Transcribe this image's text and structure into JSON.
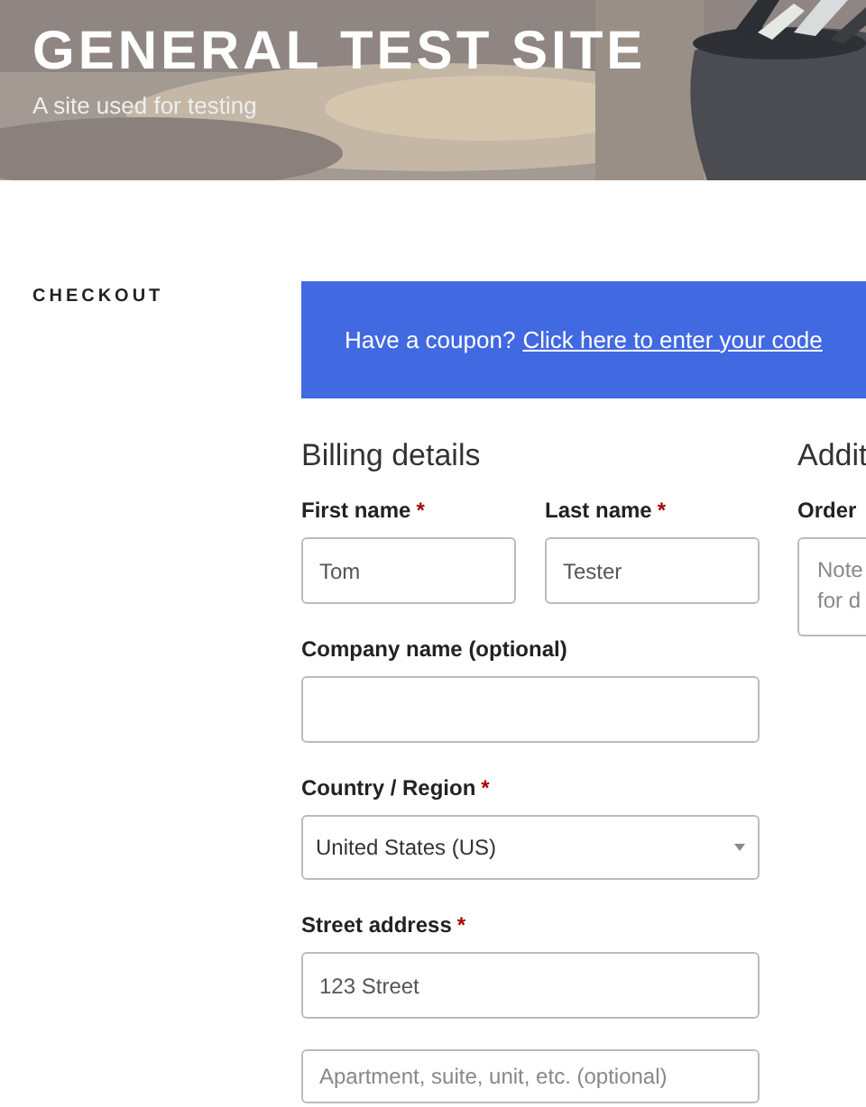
{
  "site": {
    "title": "GENERAL TEST SITE",
    "tagline": "A site used for testing"
  },
  "page_title": "CHECKOUT",
  "coupon": {
    "text": "Have a coupon?",
    "link": "Click here to enter your code"
  },
  "billing": {
    "heading": "Billing details",
    "fields": [
      {
        "kind": "input",
        "label": "First name",
        "required_mark": "*",
        "value": "Tom",
        "half": true
      },
      {
        "kind": "input",
        "label": "Last name",
        "required_mark": "*",
        "value": "Tester",
        "half": true
      },
      {
        "kind": "input",
        "label": "Company name (optional)",
        "half": false
      },
      {
        "kind": "select",
        "label": "Country / Region",
        "required_mark": "*",
        "value": "United States (US)",
        "half": false
      },
      {
        "kind": "input",
        "label": "Street address",
        "required_mark": "*",
        "value": "123 Street",
        "half": false
      },
      {
        "kind": "input",
        "placeholder": "Apartment, suite, unit, etc. (optional)",
        "half": false
      }
    ]
  },
  "additional": {
    "heading": "Addit",
    "notes_label": "Order",
    "notes_placeholder_lines": [
      "Note",
      "for d"
    ]
  }
}
